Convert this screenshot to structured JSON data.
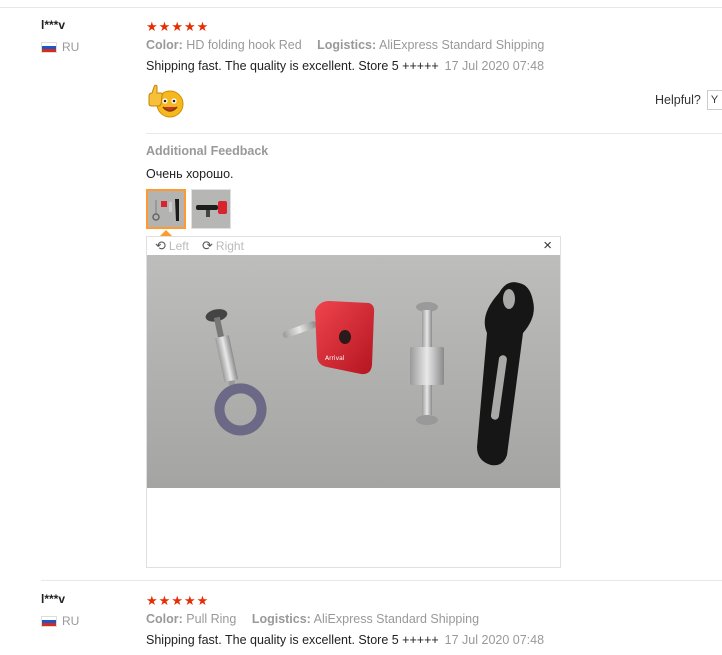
{
  "review1": {
    "user": "l***v",
    "country": "RU",
    "stars": 5,
    "color_label": "Color:",
    "color_value": "HD folding hook Red",
    "logistics_label": "Logistics:",
    "logistics_value": "AliExpress Standard Shipping",
    "text": "Shipping fast. The quality is excellent. Store 5 +++++",
    "date": "17 Jul 2020 07:48",
    "helpful_label": "Helpful?",
    "helpful_btn": "Y",
    "additional_title": "Additional Feedback",
    "additional_text": "Очень хорошо.",
    "viewer": {
      "rotate_left": "Left",
      "rotate_right": "Right",
      "close": "×"
    }
  },
  "review2": {
    "user": "l***v",
    "country": "RU",
    "stars": 5,
    "color_label": "Color:",
    "color_value": "Pull Ring",
    "logistics_label": "Logistics:",
    "logistics_value": "AliExpress Standard Shipping",
    "text": "Shipping fast. The quality is excellent. Store 5 +++++",
    "date": "17 Jul 2020 07:48"
  },
  "colors": {
    "star": "#e62e04",
    "active_thumb": "#ff9a2e"
  }
}
